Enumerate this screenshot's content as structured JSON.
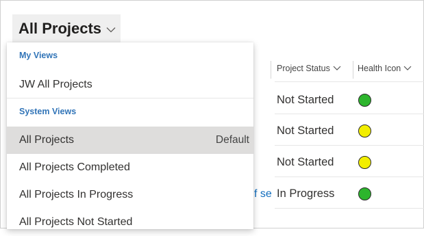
{
  "header": {
    "view_title": "All Projects"
  },
  "grid": {
    "columns": [
      {
        "label": "Project Status"
      },
      {
        "label": "Health Icon"
      }
    ],
    "partial_text": "f se",
    "rows": [
      {
        "status": "Not Started",
        "health_color": "#2db52d"
      },
      {
        "status": "Not Started",
        "health_color": "#f2ee00"
      },
      {
        "status": "Not Started",
        "health_color": "#f2ee00"
      },
      {
        "status": "In Progress",
        "health_color": "#2db52d"
      }
    ]
  },
  "dropdown": {
    "my_views_label": "My Views",
    "my_views": [
      {
        "label": "JW All Projects"
      }
    ],
    "system_views_label": "System Views",
    "system_views": [
      {
        "label": "All Projects",
        "tag": "Default",
        "selected": true
      },
      {
        "label": "All Projects Completed"
      },
      {
        "label": "All Projects In Progress"
      },
      {
        "label": "All Projects Not Started"
      }
    ]
  },
  "colors": {
    "group_label": "#3275b8",
    "selected_bg": "#dedddc",
    "link_text": "#0f6cbd"
  }
}
